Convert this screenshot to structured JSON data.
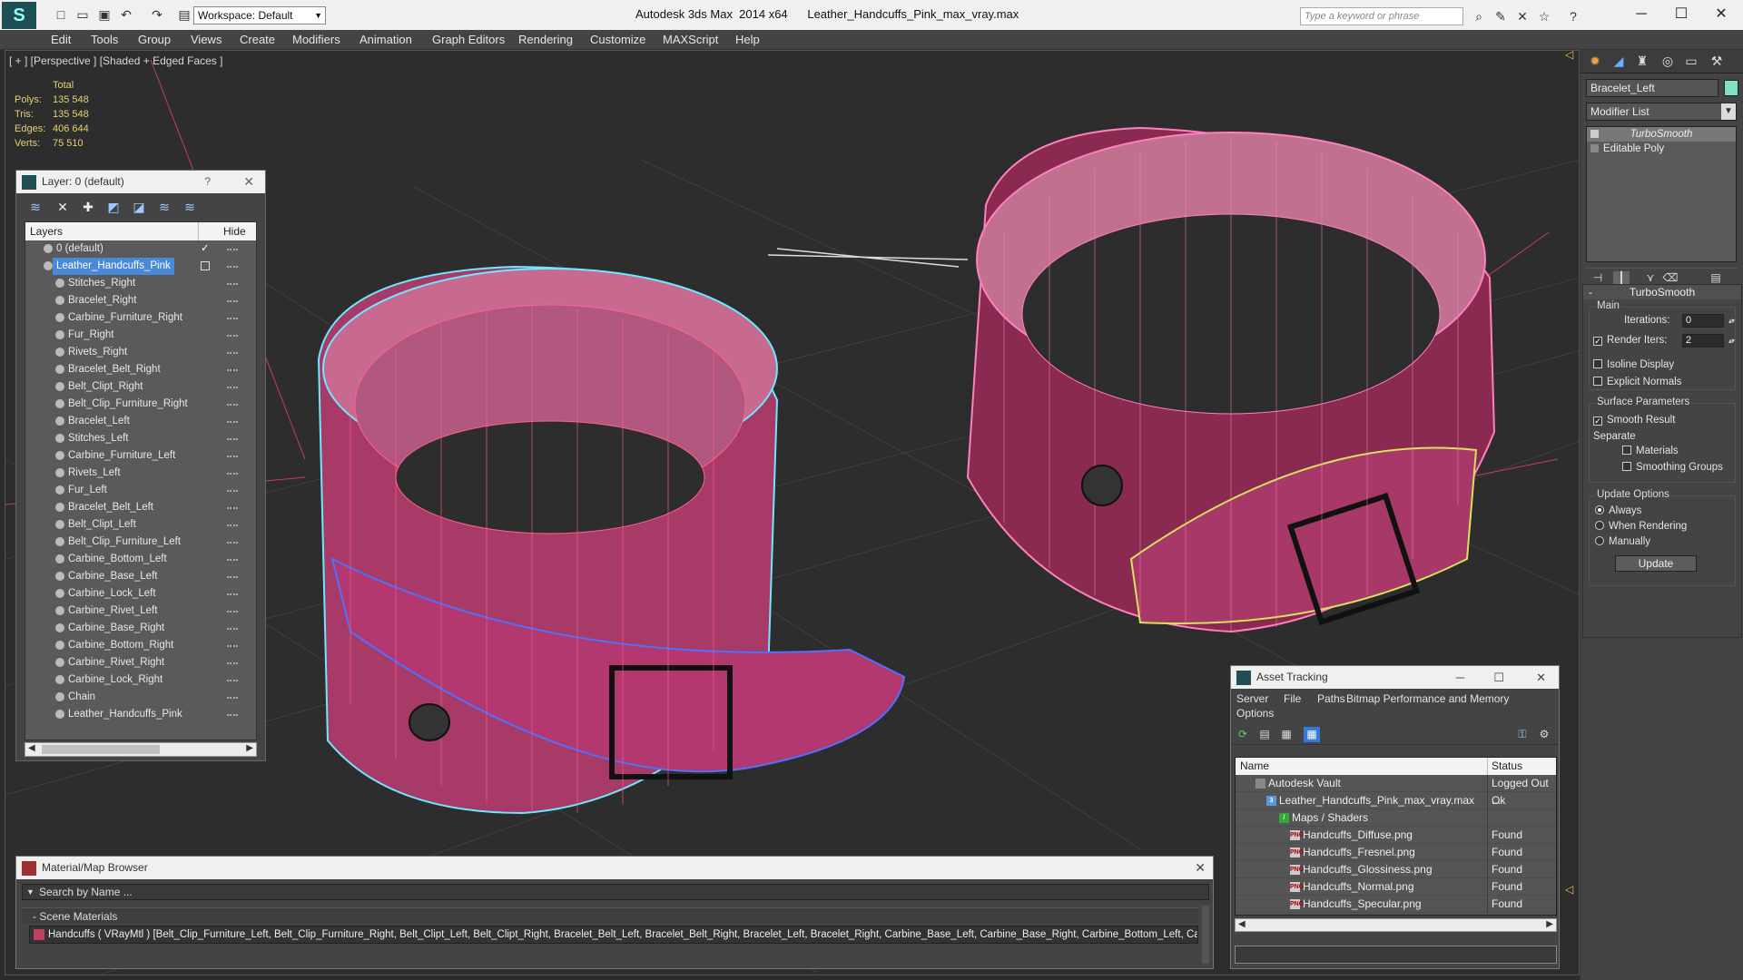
{
  "app": {
    "title": "Autodesk 3ds Max  2014 x64",
    "file": "Leather_Handcuffs_Pink_max_vray.max",
    "workspace": "Workspace: Default",
    "search_placeholder": "Type a keyword or phrase"
  },
  "menu": [
    "Edit",
    "Tools",
    "Group",
    "Views",
    "Create",
    "Modifiers",
    "Animation",
    "Graph Editors",
    "Rendering",
    "Customize",
    "MAXScript",
    "Help"
  ],
  "viewport": {
    "label": "[ + ] [Perspective ] [Shaded + Edged Faces ]",
    "stats": {
      "total_label": "Total",
      "polys_label": "Polys:",
      "polys": "135 548",
      "tris_label": "Tris:",
      "tris": "135 548",
      "edges_label": "Edges:",
      "edges": "406 644",
      "verts_label": "Verts:",
      "verts": "75 510"
    }
  },
  "layer_panel": {
    "title": "Layer: 0 (default)",
    "help": "?",
    "col_layers": "Layers",
    "col_hide": "Hide",
    "rows": [
      "0 (default)",
      "Leather_Handcuffs_Pink",
      "Stitches_Right",
      "Bracelet_Right",
      "Carbine_Furniture_Right",
      "Fur_Right",
      "Rivets_Right",
      "Bracelet_Belt_Right",
      "Belt_Clipt_Right",
      "Belt_Clip_Furniture_Right",
      "Bracelet_Left",
      "Stitches_Left",
      "Carbine_Furniture_Left",
      "Rivets_Left",
      "Fur_Left",
      "Bracelet_Belt_Left",
      "Belt_Clipt_Left",
      "Belt_Clip_Furniture_Left",
      "Carbine_Bottom_Left",
      "Carbine_Base_Left",
      "Carbine_Lock_Left",
      "Carbine_Rivet_Left",
      "Carbine_Base_Right",
      "Carbine_Bottom_Right",
      "Carbine_Rivet_Right",
      "Carbine_Lock_Right",
      "Chain",
      "Leather_Handcuffs_Pink"
    ]
  },
  "command_panel": {
    "object_name": "Bracelet_Left",
    "object_color": "#7ee0c6",
    "modifier_list": "Modifier List",
    "stack": [
      "TurboSmooth",
      "Editable Poly"
    ],
    "turbosmooth": {
      "title": "TurboSmooth",
      "main": "Main",
      "iterations_label": "Iterations:",
      "iterations": "0",
      "render_iters_label": "Render Iters:",
      "render_iters": "2",
      "isoline": "Isoline Display",
      "explicit_normals": "Explicit Normals",
      "surface_params": "Surface Parameters",
      "smooth_result": "Smooth Result",
      "separate": "Separate",
      "materials": "Materials",
      "smoothing_groups": "Smoothing Groups",
      "update_options": "Update Options",
      "always": "Always",
      "when_rendering": "When Rendering",
      "manually": "Manually",
      "update": "Update"
    }
  },
  "asset_tracking": {
    "title": "Asset Tracking",
    "menu": [
      "Server",
      "File",
      "Paths",
      "Bitmap Performance and Memory",
      "Options"
    ],
    "col_name": "Name",
    "col_status": "Status",
    "rows": [
      {
        "name": "Autodesk Vault",
        "status": "Logged Out ..."
      },
      {
        "name": "Leather_Handcuffs_Pink_max_vray.max",
        "status": "Ok"
      },
      {
        "name": "Maps / Shaders",
        "status": ""
      },
      {
        "name": "Handcuffs_Diffuse.png",
        "status": "Found"
      },
      {
        "name": "Handcuffs_Fresnel.png",
        "status": "Found"
      },
      {
        "name": "Handcuffs_Glossiness.png",
        "status": "Found"
      },
      {
        "name": "Handcuffs_Normal.png",
        "status": "Found"
      },
      {
        "name": "Handcuffs_Specular.png",
        "status": "Found"
      }
    ]
  },
  "material_browser": {
    "title": "Material/Map Browser",
    "search": "Search by Name ...",
    "section": "- Scene Materials",
    "material": "Handcuffs ( VRayMtl ) [Belt_Clip_Furniture_Left, Belt_Clip_Furniture_Right, Belt_Clipt_Left, Belt_Clipt_Right, Bracelet_Belt_Left, Bracelet_Belt_Right, Bracelet_Left, Bracelet_Right, Carbine_Base_Left, Carbine_Base_Right, Carbine_Bottom_Left, Carbi..."
  }
}
